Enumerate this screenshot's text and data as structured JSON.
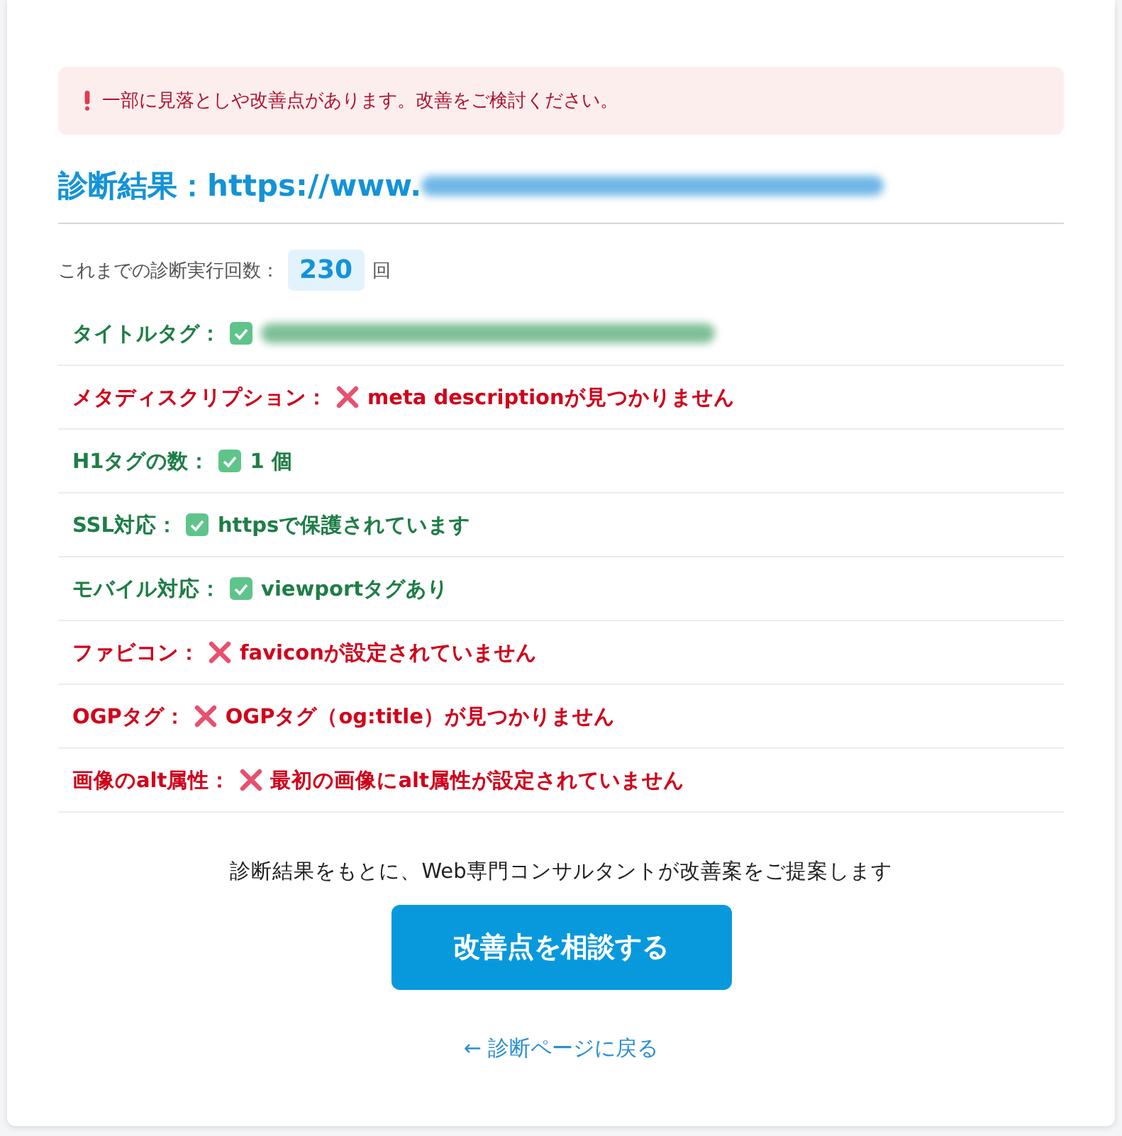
{
  "alert": {
    "message": "一部に見落としや改善点があります。改善をご検討ください。"
  },
  "heading": {
    "label": "診断結果：",
    "url": "https://www.",
    "url_blurred": true
  },
  "run_count": {
    "label": "これまでの診断実行回数：",
    "count": "230",
    "unit": "回"
  },
  "checks": [
    {
      "label": "タイトルタグ：",
      "kind": "pass",
      "value_blurred": true
    },
    {
      "label": "メタディスクリプション：",
      "kind": "fail",
      "value": "meta descriptionが見つかりません"
    },
    {
      "label": "H1タグの数：",
      "kind": "pass",
      "value": "1 個"
    },
    {
      "label": "SSL対応：",
      "kind": "pass",
      "value": "httpsで保護されています"
    },
    {
      "label": "モバイル対応：",
      "kind": "pass",
      "value": "viewportタグあり"
    },
    {
      "label": "ファビコン：",
      "kind": "fail",
      "value": "faviconが設定されていません"
    },
    {
      "label": "OGPタグ：",
      "kind": "fail",
      "value": "OGPタグ（og:title）が見つかりません"
    },
    {
      "label": "画像のalt属性：",
      "kind": "fail",
      "value": "最初の画像にalt属性が設定されていません"
    }
  ],
  "cta": {
    "lead": "診断結果をもとに、Web専門コンサルタントが改善案をご提案します",
    "button": "改善点を相談する"
  },
  "back_link": "← 診断ページに戻る"
}
